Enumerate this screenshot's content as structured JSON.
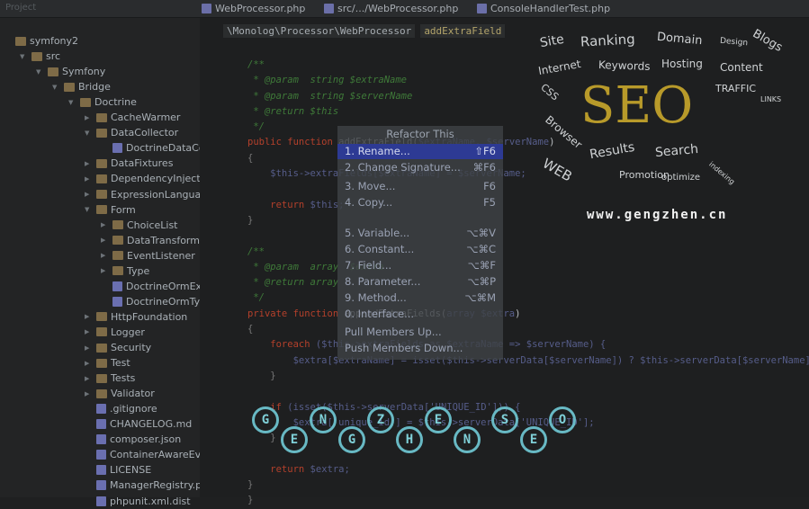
{
  "topbar": {
    "project_label": "Project",
    "tabs": [
      "WebProcessor.php",
      "src/.../WebProcessor.php",
      "ConsoleHandlerTest.php"
    ]
  },
  "breadcrumb": [
    "\\Monolog\\Processor\\WebProcessor",
    "addExtraField"
  ],
  "tree": [
    {
      "d": 0,
      "t": "symfony2",
      "k": "folder",
      "o": ""
    },
    {
      "d": 1,
      "t": "src",
      "k": "folder",
      "o": "▼"
    },
    {
      "d": 2,
      "t": "Symfony",
      "k": "folder",
      "o": "▼"
    },
    {
      "d": 3,
      "t": "Bridge",
      "k": "folder",
      "o": "▼"
    },
    {
      "d": 4,
      "t": "Doctrine",
      "k": "folder",
      "o": "▼"
    },
    {
      "d": 5,
      "t": "CacheWarmer",
      "k": "folder",
      "o": "▶"
    },
    {
      "d": 5,
      "t": "DataCollector",
      "k": "folder",
      "o": "▼"
    },
    {
      "d": 6,
      "t": "DoctrineDataCollec",
      "k": "file",
      "o": ""
    },
    {
      "d": 5,
      "t": "DataFixtures",
      "k": "folder",
      "o": "▶"
    },
    {
      "d": 5,
      "t": "DependencyInjection",
      "k": "folder",
      "o": "▶"
    },
    {
      "d": 5,
      "t": "ExpressionLanguage",
      "k": "folder",
      "o": "▶"
    },
    {
      "d": 5,
      "t": "Form",
      "k": "folder",
      "o": "▼"
    },
    {
      "d": 6,
      "t": "ChoiceList",
      "k": "folder",
      "o": "▶"
    },
    {
      "d": 6,
      "t": "DataTransformer",
      "k": "folder",
      "o": "▶"
    },
    {
      "d": 6,
      "t": "EventListener",
      "k": "folder",
      "o": "▶"
    },
    {
      "d": 6,
      "t": "Type",
      "k": "folder",
      "o": "▶"
    },
    {
      "d": 6,
      "t": "DoctrineOrmExten",
      "k": "file",
      "o": ""
    },
    {
      "d": 6,
      "t": "DoctrineOrmTypeG",
      "k": "file",
      "o": ""
    },
    {
      "d": 5,
      "t": "HttpFoundation",
      "k": "folder",
      "o": "▶"
    },
    {
      "d": 5,
      "t": "Logger",
      "k": "folder",
      "o": "▶"
    },
    {
      "d": 5,
      "t": "Security",
      "k": "folder",
      "o": "▶"
    },
    {
      "d": 5,
      "t": "Test",
      "k": "folder",
      "o": "▶"
    },
    {
      "d": 5,
      "t": "Tests",
      "k": "folder",
      "o": "▶"
    },
    {
      "d": 5,
      "t": "Validator",
      "k": "folder",
      "o": "▶"
    },
    {
      "d": 5,
      "t": ".gitignore",
      "k": "file",
      "o": ""
    },
    {
      "d": 5,
      "t": "CHANGELOG.md",
      "k": "file",
      "o": ""
    },
    {
      "d": 5,
      "t": "composer.json",
      "k": "file",
      "o": ""
    },
    {
      "d": 5,
      "t": "ContainerAwareEventN",
      "k": "file",
      "o": ""
    },
    {
      "d": 5,
      "t": "LICENSE",
      "k": "file",
      "o": ""
    },
    {
      "d": 5,
      "t": "ManagerRegistry.php",
      "k": "file",
      "o": ""
    },
    {
      "d": 5,
      "t": "phpunit.xml.dist",
      "k": "file",
      "o": ""
    }
  ],
  "code": [
    [
      [
        "c",
        "/**"
      ]
    ],
    [
      [
        "c",
        " * @param  string $extraName"
      ]
    ],
    [
      [
        "c",
        " * @param  string $serverName"
      ]
    ],
    [
      [
        "c",
        " * @return $this"
      ]
    ],
    [
      [
        "c",
        " */"
      ]
    ],
    [
      [
        "k",
        "public function "
      ],
      [
        "f",
        "addExtraField("
      ],
      [
        "v",
        "$extraName, $serverName"
      ],
      [
        "f",
        ")"
      ]
    ],
    [
      [
        "p",
        "{"
      ]
    ],
    [
      [
        "v",
        "    $this->extraFields[$extraName] = $serverName;"
      ]
    ],
    [
      [
        "p",
        ""
      ]
    ],
    [
      [
        "k",
        "    return "
      ],
      [
        "v",
        "$this;"
      ]
    ],
    [
      [
        "p",
        "}"
      ]
    ],
    [
      [
        "p",
        ""
      ]
    ],
    [
      [
        "c",
        "/**"
      ]
    ],
    [
      [
        "c",
        " * @param  array  $extra"
      ]
    ],
    [
      [
        "c",
        " * @return array"
      ]
    ],
    [
      [
        "c",
        " */"
      ]
    ],
    [
      [
        "k",
        "private function "
      ],
      [
        "f",
        "appendExtraFields("
      ],
      [
        "v",
        "array $extra"
      ],
      [
        "f",
        ")"
      ]
    ],
    [
      [
        "p",
        "{"
      ]
    ],
    [
      [
        "k",
        "    foreach "
      ],
      [
        "v",
        "($this->extraFields as $extraName => $serverName) {"
      ]
    ],
    [
      [
        "v",
        "        $extra[$extraName] = isset($this->serverData[$serverName]) ? $this->serverData[$serverName]"
      ]
    ],
    [
      [
        "p",
        "    }"
      ]
    ],
    [
      [
        "p",
        ""
      ]
    ],
    [
      [
        "k",
        "    if "
      ],
      [
        "v",
        "(isset($this->serverData['UNIQUE_ID'])) {"
      ]
    ],
    [
      [
        "v",
        "        $extra['unique_id'] = $this->serverData['UNIQUE_ID'];"
      ]
    ],
    [
      [
        "p",
        "    }"
      ]
    ],
    [
      [
        "p",
        ""
      ]
    ],
    [
      [
        "k",
        "    return "
      ],
      [
        "v",
        "$extra;"
      ]
    ],
    [
      [
        "p",
        "}"
      ]
    ],
    [
      [
        "p",
        "}"
      ]
    ]
  ],
  "menu": {
    "title": "Refactor This",
    "items": [
      {
        "label": "1. Rename...",
        "key": "⇧F6",
        "selected": true
      },
      {
        "label": "2. Change Signature...",
        "key": "⌘F6"
      },
      {
        "label": "3. Move...",
        "key": "F6"
      },
      {
        "label": "4. Copy...",
        "key": "F5"
      },
      {
        "label": "5. Variable...",
        "key": "⌥⌘V"
      },
      {
        "label": "6. Constant...",
        "key": "⌥⌘C"
      },
      {
        "label": "7. Field...",
        "key": "⌥⌘F"
      },
      {
        "label": "8. Parameter...",
        "key": "⌥⌘P"
      },
      {
        "label": "9. Method...",
        "key": "⌥⌘M"
      },
      {
        "label": "0. Interface...",
        "key": ""
      },
      {
        "label": "Pull Members Up...",
        "key": ""
      },
      {
        "label": "Push Members Down...",
        "key": ""
      }
    ]
  },
  "watermark": {
    "words": [
      "Site",
      "Ranking",
      "Domain",
      "Design",
      "Blogs",
      "Internet",
      "Keywords",
      "Hosting",
      "Content",
      "CSS",
      "SEO",
      "TRAFFIC",
      "LINKS",
      "Browser",
      "Results",
      "Search",
      "WEB",
      "Promotion",
      "optimize",
      "indexing"
    ],
    "url": "www.gengzhen.cn",
    "bulbs": [
      "G",
      "E",
      "N",
      "G",
      "Z",
      "H",
      "E",
      "N",
      "S",
      "E",
      "O"
    ]
  },
  "colors": {
    "selection": "#2d3a94",
    "keyword": "#b4402b",
    "comment": "#3f7a39"
  }
}
